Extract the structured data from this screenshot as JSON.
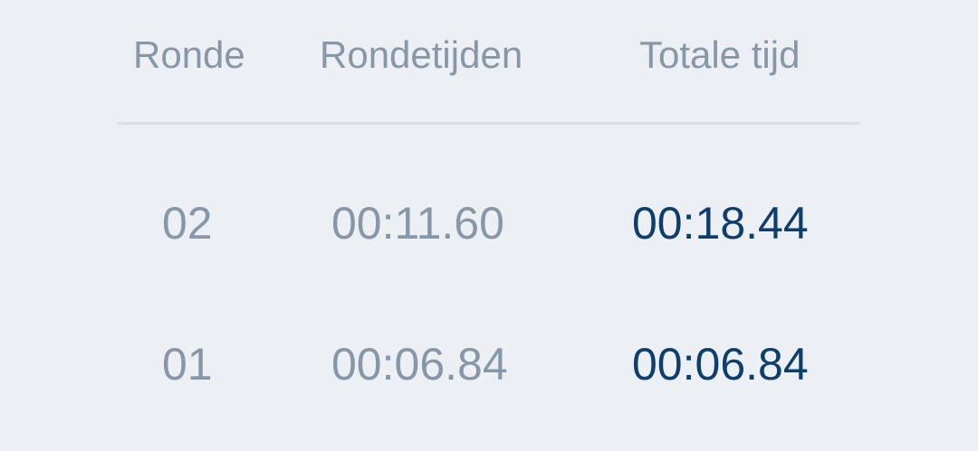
{
  "header": {
    "lap_label": "Ronde",
    "split_label": "Rondetijden",
    "total_label": "Totale tijd"
  },
  "laps": [
    {
      "lap": "02",
      "split": "00:11.60",
      "total": "00:18.44"
    },
    {
      "lap": "01",
      "split": "00:06.84",
      "total": "00:06.84"
    }
  ],
  "colors": {
    "background": "#eceff3",
    "muted_text": "#8797a7",
    "total_text": "#0e3e6b",
    "divider": "#dde1e6"
  }
}
